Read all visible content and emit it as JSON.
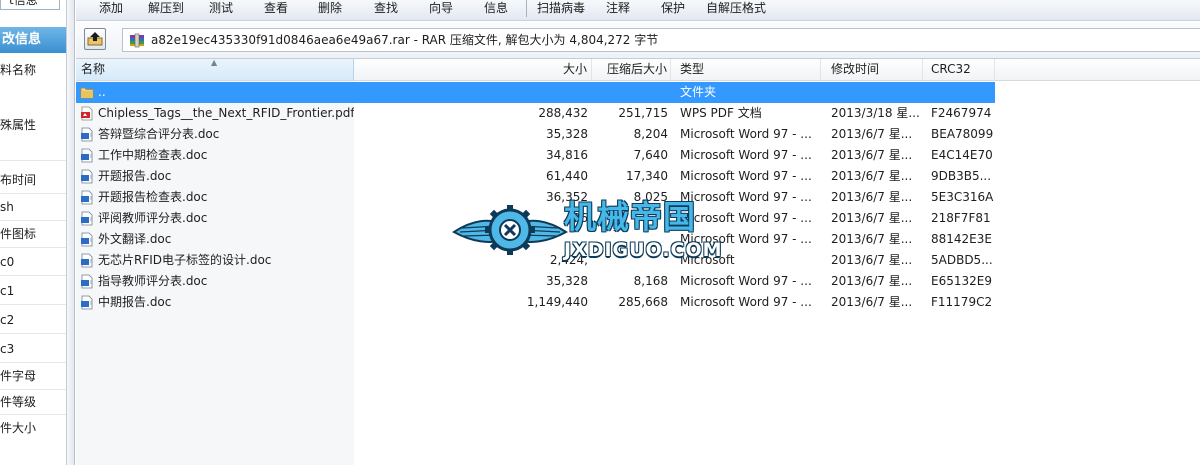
{
  "left_panel": {
    "top_fragment": "t信息",
    "header": "改信息",
    "items": [
      "料名称",
      "殊属性",
      "布时间",
      "sh",
      "件图标",
      "c0",
      "c1",
      "c2",
      "c3",
      "件字母",
      "件等级",
      "件大小"
    ]
  },
  "toolbar": {
    "buttons": [
      "添加",
      "解压到",
      "测试",
      "查看",
      "删除",
      "查找",
      "向导",
      "信息",
      "扫描病毒",
      "注释",
      "保护",
      "自解压格式"
    ]
  },
  "address_bar": {
    "path": "a82e19ec435330f91d0846aea6e49a67.rar - RAR 压缩文件, 解包大小为 4,804,272 字节",
    "up_icon": "up-folder-icon",
    "archive_icon": "rar-archive-icon"
  },
  "list": {
    "columns": [
      "名称",
      "大小",
      "压缩后大小",
      "类型",
      "修改时间",
      "CRC32"
    ],
    "rows": [
      {
        "icon": "parent-folder-icon",
        "name": "..",
        "size": "",
        "packed": "",
        "type": "文件夹",
        "modified": "",
        "crc": "",
        "selected": true
      },
      {
        "icon": "pdf-file-icon",
        "name": "Chipless_Tags__the_Next_RFID_Frontier.pdf",
        "size": "288,432",
        "packed": "251,715",
        "type": "WPS PDF 文档",
        "modified": "2013/3/18 星...",
        "crc": "F2467974"
      },
      {
        "icon": "doc-file-icon",
        "name": "答辩暨综合评分表.doc",
        "size": "35,328",
        "packed": "8,204",
        "type": "Microsoft Word 97 - ...",
        "modified": "2013/6/7 星...",
        "crc": "BEA78099"
      },
      {
        "icon": "doc-file-icon",
        "name": "工作中期检查表.doc",
        "size": "34,816",
        "packed": "7,640",
        "type": "Microsoft Word 97 - ...",
        "modified": "2013/6/7 星...",
        "crc": "E4C14E70"
      },
      {
        "icon": "doc-file-icon",
        "name": "开题报告.doc",
        "size": "61,440",
        "packed": "17,340",
        "type": "Microsoft Word 97 - ...",
        "modified": "2013/6/7 星...",
        "crc": "9DB3B5..."
      },
      {
        "icon": "doc-file-icon",
        "name": "开题报告检查表.doc",
        "size": "36,352",
        "packed": "8,025",
        "type": "Microsoft Word 97 - ...",
        "modified": "2013/6/7 星...",
        "crc": "5E3C316A"
      },
      {
        "icon": "doc-file-icon",
        "name": "评阅教师评分表.doc",
        "size": "36",
        "packed": "",
        "type": "Microsoft Word 97 - ...",
        "modified": "2013/6/7 星...",
        "crc": "218F7F81"
      },
      {
        "icon": "doc-file-icon",
        "name": "外文翻译.doc",
        "size": "",
        "packed": "",
        "type": "Microsoft Word 97 - ...",
        "modified": "2013/6/7 星...",
        "crc": "88142E3E"
      },
      {
        "icon": "doc-file-icon",
        "name": "无芯片RFID电子标签的设计.doc",
        "size": "2,424,",
        "packed": "",
        "type": "Microsoft",
        "modified": "2013/6/7 星...",
        "crc": "5ADBD5..."
      },
      {
        "icon": "doc-file-icon",
        "name": "指导教师评分表.doc",
        "size": "35,328",
        "packed": "8,168",
        "type": "Microsoft Word 97 - ...",
        "modified": "2013/6/7 星...",
        "crc": "E65132E9"
      },
      {
        "icon": "doc-file-icon",
        "name": "中期报告.doc",
        "size": "1,149,440",
        "packed": "285,668",
        "type": "Microsoft Word 97 - ...",
        "modified": "2013/6/7 星...",
        "crc": "F11179C2"
      }
    ]
  },
  "watermark": {
    "cn": "机械帝国",
    "en": "JXDIGUO.COM",
    "logo_icon": "winged-gear-logo-icon"
  },
  "colors": {
    "selection": "#3399ff",
    "left_header": "#3b8fd1",
    "watermark_blue": "#45b7e8"
  }
}
